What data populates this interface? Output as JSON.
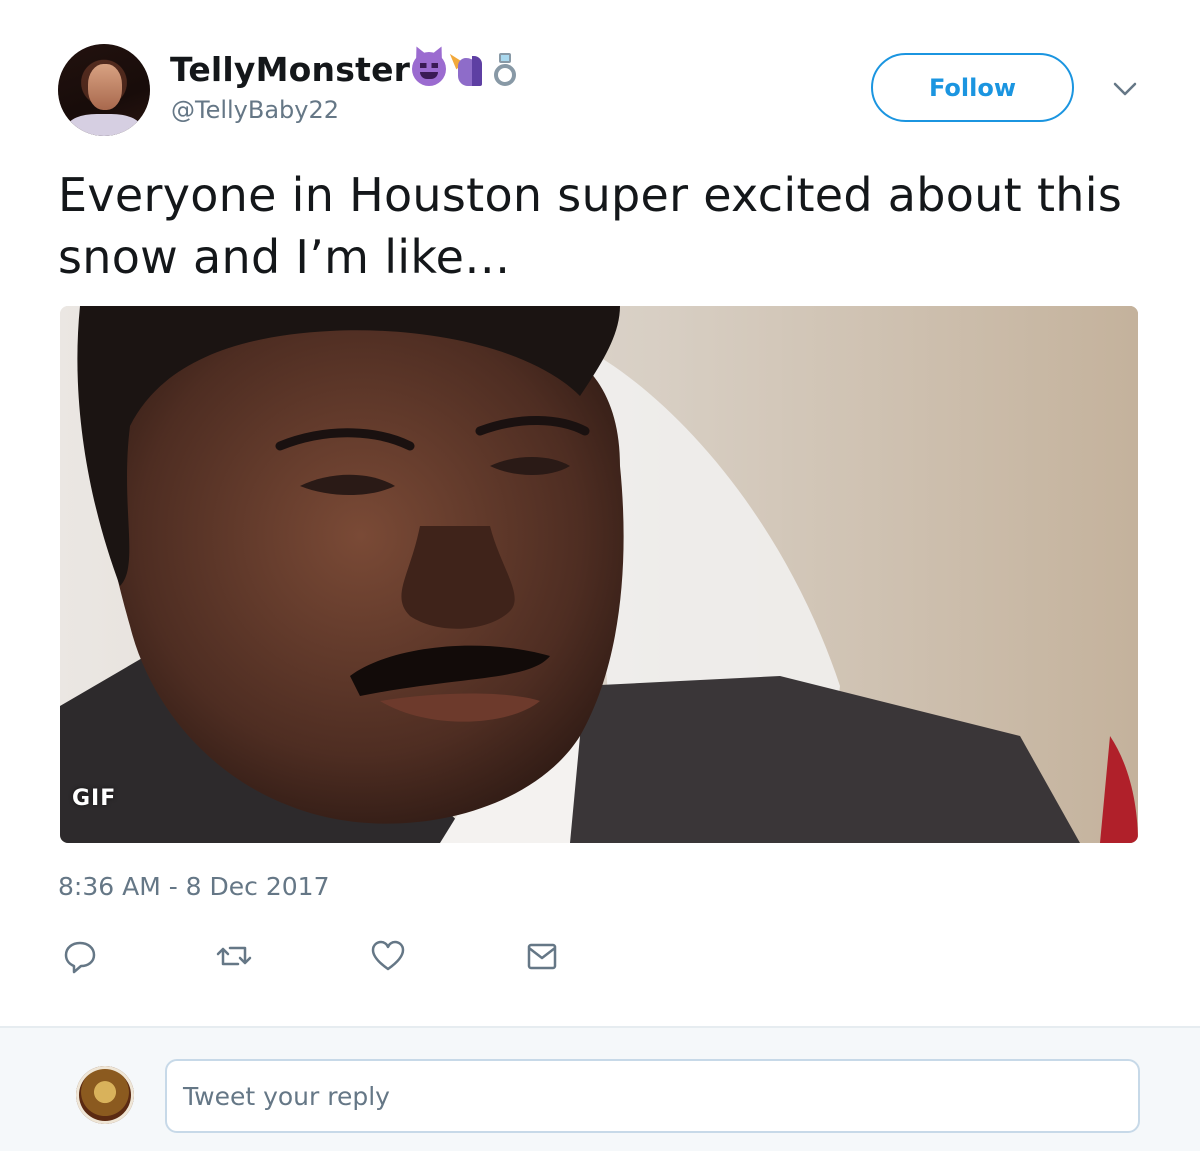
{
  "author": {
    "display_name": "TellyMonster",
    "handle": "@TellyBaby22",
    "name_emojis": [
      "smiling-devil-emoji",
      "unicorn-emoji",
      "ring-emoji"
    ]
  },
  "follow_button": {
    "label": "Follow"
  },
  "tweet": {
    "text": "Everyone in Houston super excited about this snow and I’m like…",
    "timestamp": "8:36 AM - 8 Dec 2017"
  },
  "media": {
    "badge": "GIF"
  },
  "actions": [
    "reply-icon",
    "retweet-icon",
    "like-icon",
    "message-icon"
  ],
  "reply": {
    "placeholder": "Tweet your reply"
  },
  "colors": {
    "accent": "#1b95e0",
    "secondary_text": "#657786",
    "primary_text": "#14171a",
    "reply_bar_bg": "#f5f8fa"
  }
}
